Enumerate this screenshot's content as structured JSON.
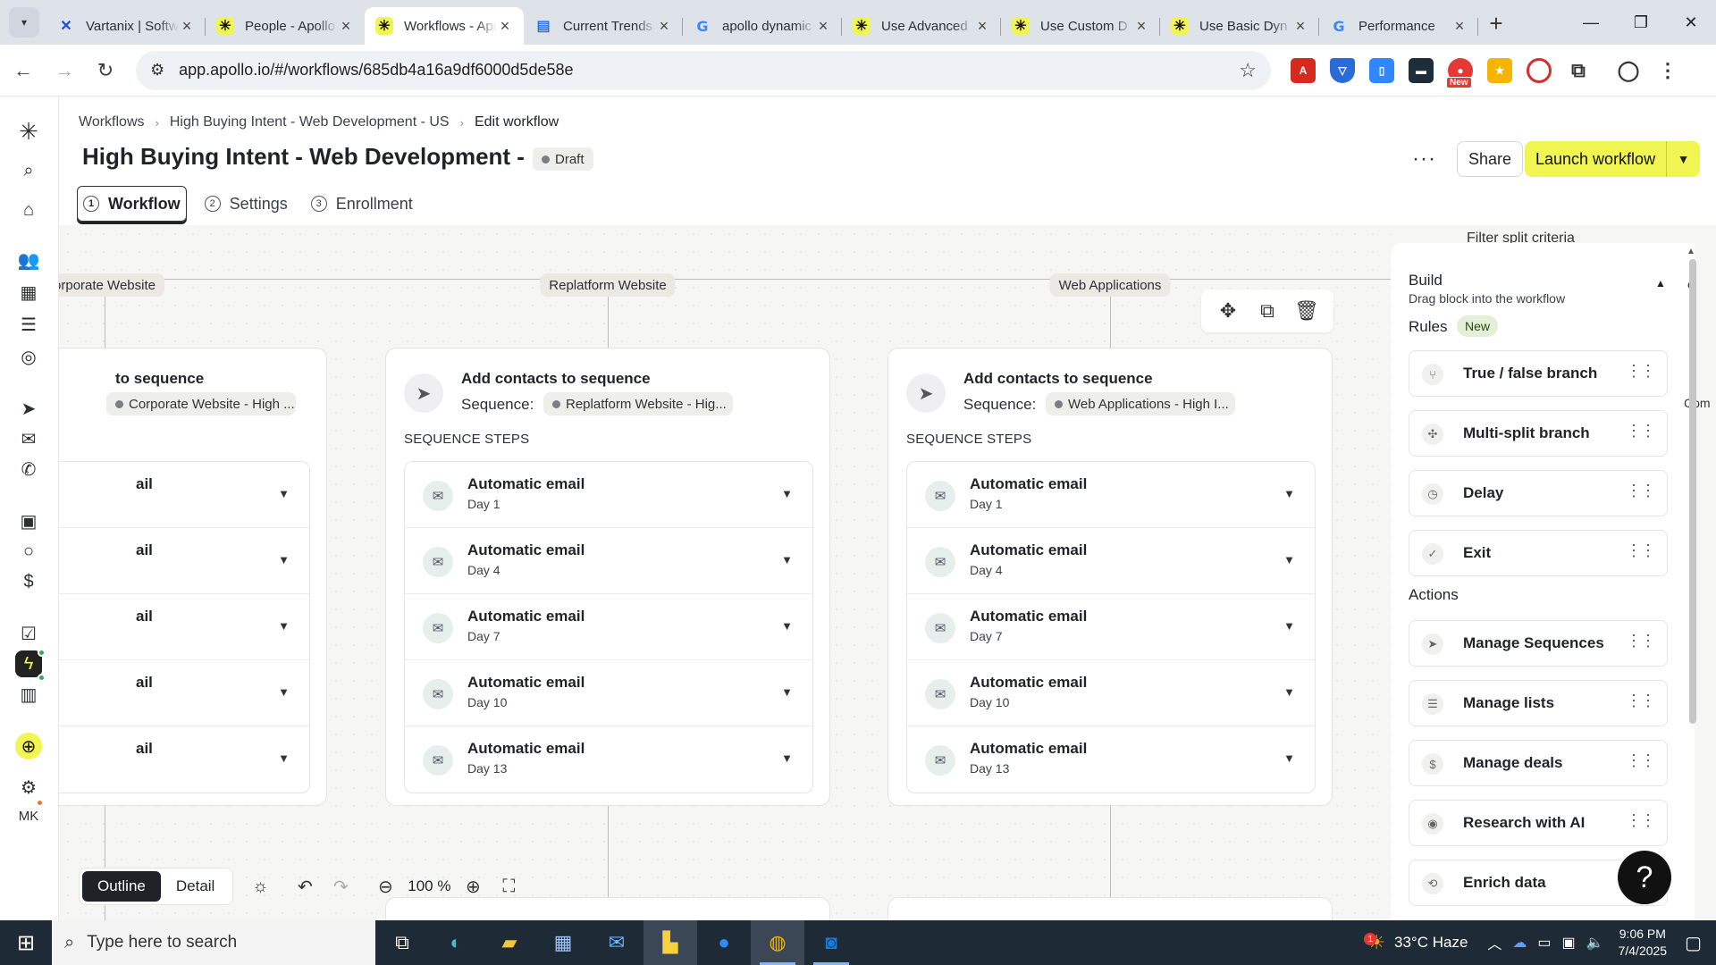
{
  "browser": {
    "tabs": [
      {
        "title": "Vartanix | Software",
        "favicon": "x-logo-icon"
      },
      {
        "title": "People - Apollo",
        "favicon": "apollo-icon"
      },
      {
        "title": "Workflows - Apollo",
        "favicon": "apollo-icon",
        "active": true
      },
      {
        "title": "Current Trends",
        "favicon": "docs-icon"
      },
      {
        "title": "apollo dynamic",
        "favicon": "google-icon"
      },
      {
        "title": "Use Advanced",
        "favicon": "apollo-icon"
      },
      {
        "title": "Use Custom D",
        "favicon": "apollo-icon"
      },
      {
        "title": "Use Basic Dyn",
        "favicon": "apollo-icon"
      },
      {
        "title": "Performance",
        "favicon": "google-icon"
      }
    ],
    "url": "app.apollo.io/#/workflows/685db4a16a9df6000d5de58e",
    "extension_badge": "New"
  },
  "user": {
    "initials": "MK"
  },
  "breadcrumb": [
    "Workflows",
    "High Buying Intent - Web Development - US",
    "Edit workflow"
  ],
  "page": {
    "title": "High Buying Intent - Web Development - ...",
    "status": "Draft",
    "more_label": "···",
    "share_label": "Share",
    "launch_label": "Launch workflow"
  },
  "tabs": [
    {
      "num": "1",
      "label": "Workflow",
      "active": true
    },
    {
      "num": "2",
      "label": "Settings"
    },
    {
      "num": "3",
      "label": "Enrollment"
    }
  ],
  "canvas": {
    "branches": [
      "orporate Website",
      "Replatform Website",
      "Web Applications"
    ],
    "cards": [
      {
        "title": "to sequence",
        "sequence_label": "",
        "sequence": "Corporate Website - High ...",
        "steps_heading": "",
        "steps": [
          {
            "title": "ail",
            "day": ""
          },
          {
            "title": "ail",
            "day": ""
          },
          {
            "title": "ail",
            "day": ""
          },
          {
            "title": "ail",
            "day": ""
          },
          {
            "title": "ail",
            "day": ""
          }
        ]
      },
      {
        "title": "Add contacts to sequence",
        "sequence_label": "Sequence:",
        "sequence": "Replatform Website - Hig...",
        "steps_heading": "SEQUENCE STEPS",
        "steps": [
          {
            "title": "Automatic email",
            "day": "Day 1"
          },
          {
            "title": "Automatic email",
            "day": "Day 4"
          },
          {
            "title": "Automatic email",
            "day": "Day 7"
          },
          {
            "title": "Automatic email",
            "day": "Day 10"
          },
          {
            "title": "Automatic email",
            "day": "Day 13"
          }
        ]
      },
      {
        "title": "Add contacts to sequence",
        "sequence_label": "Sequence:",
        "sequence": "Web Applications - High I...",
        "steps_heading": "SEQUENCE STEPS",
        "steps": [
          {
            "title": "Automatic email",
            "day": "Day 1"
          },
          {
            "title": "Automatic email",
            "day": "Day 4"
          },
          {
            "title": "Automatic email",
            "day": "Day 7"
          },
          {
            "title": "Automatic email",
            "day": "Day 10"
          },
          {
            "title": "Automatic email",
            "day": "Day 13"
          }
        ]
      }
    ],
    "view_modes": [
      "Outline",
      "Detail"
    ],
    "zoom": "100 %"
  },
  "build_panel": {
    "peek_text": "Filter split criteria",
    "title": "Build",
    "subtitle": "Drag block into the workflow",
    "rules_heading": "Rules",
    "rules_badge": "New",
    "rules": [
      "True / false branch",
      "Multi-split branch",
      "Delay",
      "Exit"
    ],
    "actions_heading": "Actions",
    "actions": [
      "Manage Sequences",
      "Manage lists",
      "Manage deals",
      "Research with AI",
      "Enrich data"
    ],
    "edge_peek": [
      "e",
      "Com"
    ]
  },
  "help_label": "?",
  "taskbar": {
    "search_placeholder": "Type here to search",
    "weather": "33°C  Haze",
    "weather_alert": "1",
    "time": "9:06 PM",
    "date": "7/4/2025"
  },
  "colors": {
    "accent": "#f1f552",
    "text": "#1f2328",
    "canvas_bg": "#f6f6f4"
  }
}
